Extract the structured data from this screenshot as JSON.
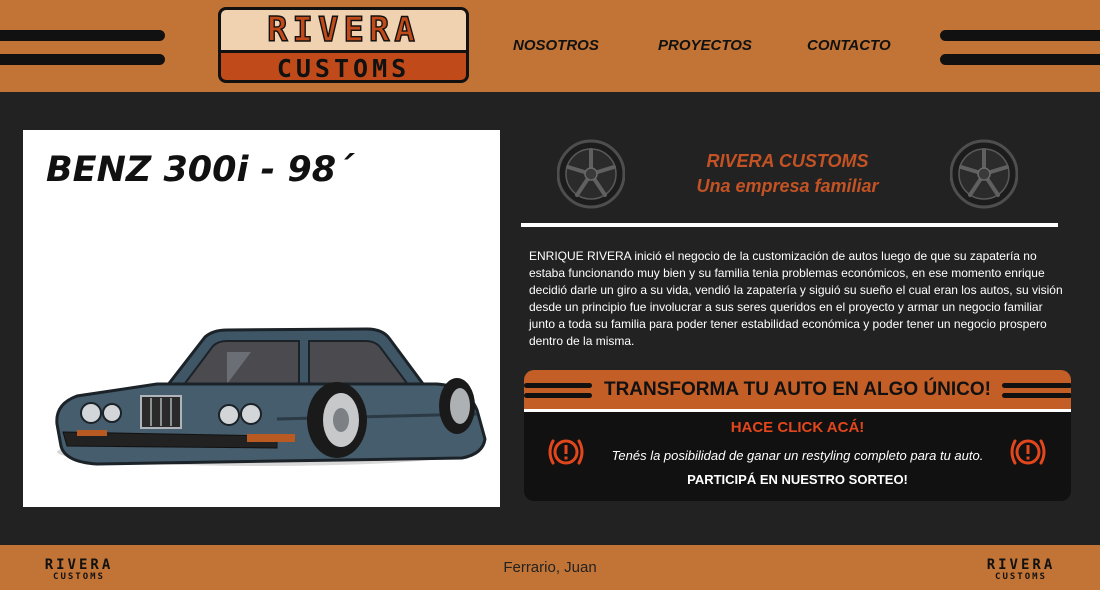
{
  "header": {
    "logo": {
      "line1": "RIVERA",
      "line2": "CUSTOMS"
    },
    "nav": [
      {
        "label": "NOSOTROS"
      },
      {
        "label": "PROYECTOS"
      },
      {
        "label": "CONTACTO"
      }
    ]
  },
  "car": {
    "title": "BENZ 300i - 98´"
  },
  "about": {
    "title": "RIVERA CUSTOMS",
    "subtitle": "Una empresa familiar",
    "paragraph": "ENRIQUE RIVERA inició el negocio de la customización de autos luego de que su zapatería no estaba funcionando muy bien y su familia tenia problemas económicos, en ese momento enrique decidió darle un giro a su vida, vendió la zapatería y siguió su sueño el cual eran los autos, su visión desde un principio fue involucrar a sus seres queridos en el proyecto y armar un negocio familiar junto a toda su familia para poder tener estabilidad económica y poder tener un negocio prospero dentro de la misma."
  },
  "promo": {
    "title": "TRANSFORMA TU AUTO EN ALGO ÚNICO!",
    "cta": "HACE CLICK ACÁ!",
    "text": "Tenés la posibilidad de ganar un restyling completo para tu auto.",
    "bold_text": "PARTICIPÁ EN NUESTRO SORTEO!"
  },
  "footer": {
    "logo": {
      "line1": "RIVERA",
      "line2": "CUSTOMS"
    },
    "author": "Ferrario, Juan"
  },
  "colors": {
    "header_bg": "#c27436",
    "page_bg": "#222222",
    "accent": "#c35224",
    "alert_red": "#e2461c"
  }
}
